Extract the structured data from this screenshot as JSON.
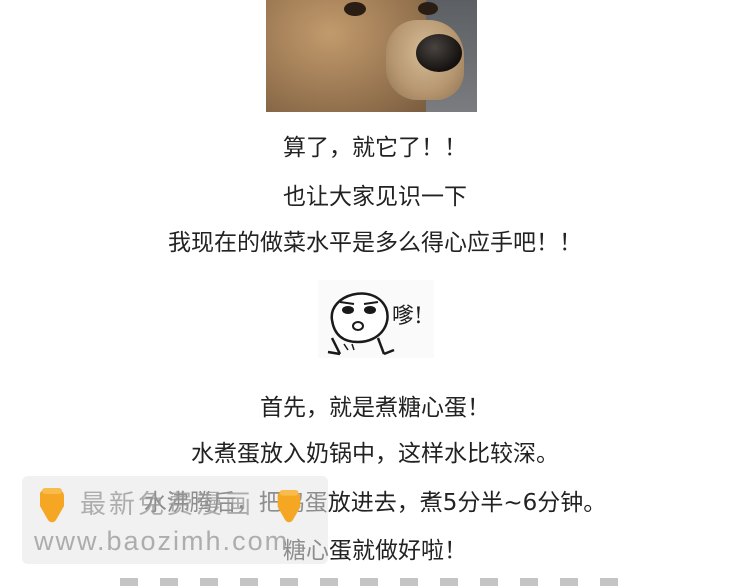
{
  "lines": [
    "算了，就它了！！",
    "也让大家见识一下",
    "我现在的做菜水平是多么得心应手吧！！",
    "首先，就是煮糖心蛋！",
    "水煮蛋放入奶锅中，这样水比较深。",
    "水沸腾后，把鸡蛋放进去，煮5分半~6分钟。",
    "糖心蛋就做好啦！"
  ],
  "sticker": {
    "text": "嗲!",
    "icon": "cartoon-face-icon"
  },
  "watermark": {
    "line1": "最新免费漫画",
    "line2": "www.baozimh.com",
    "icon": "pointing-down-hand-icon",
    "color": "#f5a623"
  },
  "images": {
    "photo": "dog-face-photo"
  }
}
